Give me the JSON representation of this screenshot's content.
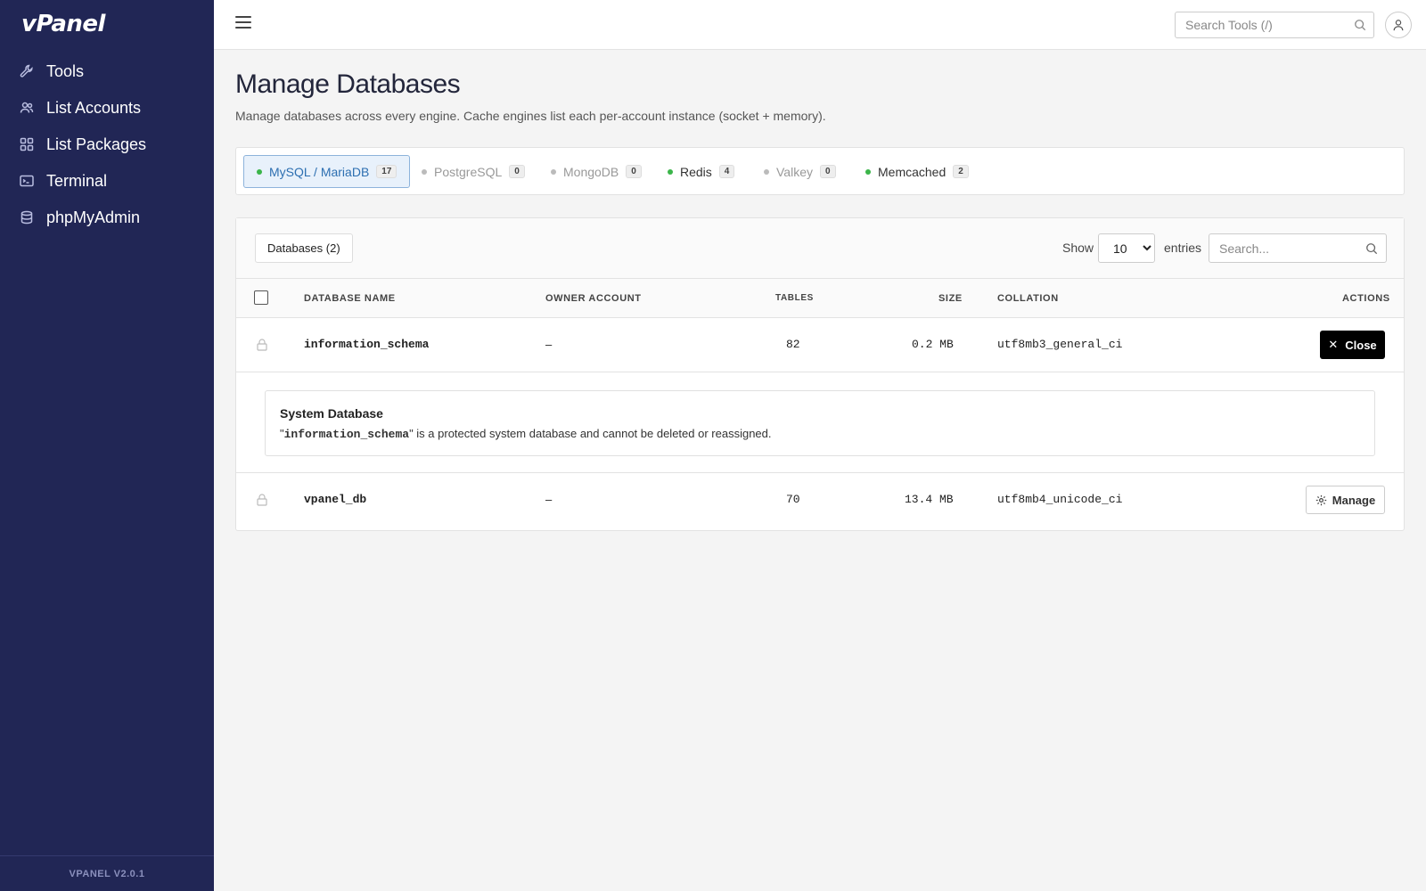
{
  "app": {
    "logo": "vPanel",
    "version": "VPANEL V2.0.1"
  },
  "sidebar": {
    "items": [
      {
        "label": "Tools",
        "icon": "wrench-icon"
      },
      {
        "label": "List Accounts",
        "icon": "users-icon"
      },
      {
        "label": "List Packages",
        "icon": "grid-icon"
      },
      {
        "label": "Terminal",
        "icon": "terminal-icon"
      },
      {
        "label": "phpMyAdmin",
        "icon": "database-icon"
      }
    ]
  },
  "topbar": {
    "search_placeholder": "Search Tools (/)"
  },
  "page": {
    "title": "Manage Databases",
    "subtitle": "Manage databases across every engine. Cache engines list each per-account instance (socket + memory)."
  },
  "engines": [
    {
      "label": "MySQL / MariaDB",
      "count": "17",
      "status": "active"
    },
    {
      "label": "PostgreSQL",
      "count": "0",
      "status": "off"
    },
    {
      "label": "MongoDB",
      "count": "0",
      "status": "off"
    },
    {
      "label": "Redis",
      "count": "4",
      "status": "on"
    },
    {
      "label": "Valkey",
      "count": "0",
      "status": "off"
    },
    {
      "label": "Memcached",
      "count": "2",
      "status": "on"
    }
  ],
  "table": {
    "count_label": "Databases (2)",
    "show_label": "Show",
    "entries_value": "10",
    "entries_label": "entries",
    "search_placeholder": "Search...",
    "columns": {
      "name": "Database Name",
      "owner": "Owner Account",
      "tables": "Tables",
      "size": "Size",
      "collation": "Collation",
      "actions": "Actions"
    },
    "rows": [
      {
        "name": "information_schema",
        "owner": "–",
        "tables": "82",
        "size": "0.2 MB",
        "collation": "utf8mb3_general_ci",
        "action": "Close"
      },
      {
        "name": "vpanel_db",
        "owner": "–",
        "tables": "70",
        "size": "13.4 MB",
        "collation": "utf8mb4_unicode_ci",
        "action": "Manage"
      }
    ],
    "detail": {
      "title": "System Database",
      "quote_open": "\"",
      "db_name": "information_schema",
      "text": "\" is a protected system database and cannot be deleted or reassigned."
    }
  }
}
